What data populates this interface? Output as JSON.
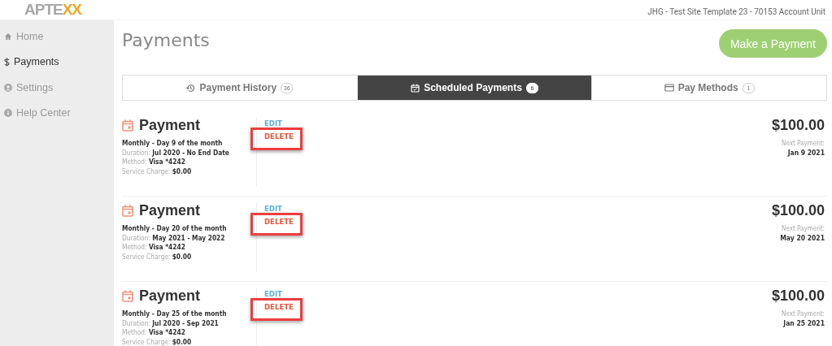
{
  "header": {
    "logo": {
      "main": "APTE",
      "accent": "XX"
    },
    "account": "JHG - Test Site Template 23 - 70153 Account Unit"
  },
  "sidebar": {
    "items": [
      {
        "label": "Home",
        "selected": false
      },
      {
        "label": "Payments",
        "selected": true
      },
      {
        "label": "Settings",
        "selected": false
      },
      {
        "label": "Help Center",
        "selected": false
      }
    ]
  },
  "page": {
    "title": "Payments",
    "action_button": "Make a Payment"
  },
  "tabs": [
    {
      "label": "Payment History",
      "count": "36",
      "selected": false
    },
    {
      "label": "Scheduled Payments",
      "count": "6",
      "selected": true
    },
    {
      "label": "Pay Methods",
      "count": "1",
      "selected": false
    }
  ],
  "payments": [
    {
      "title": "Payment",
      "frequency": "Monthly - Day 9 of the month",
      "duration": {
        "label": "Duration:",
        "value": "Jul 2020 - No End Date"
      },
      "method": {
        "label": "Method:",
        "value": "Visa *4242"
      },
      "service_charge": {
        "label": "Service Charge:",
        "value": "$0.00"
      },
      "edit": "EDIT",
      "delete": "DELETE",
      "highlighted": true,
      "amount": "$100.00",
      "next_label": "Next Payment:",
      "next_date": "Jan 9 2021"
    },
    {
      "title": "Payment",
      "frequency": "Monthly - Day 20 of the month",
      "duration": {
        "label": "Duration:",
        "value": "May 2021 - May 2022"
      },
      "method": {
        "label": "Method:",
        "value": "Visa *4242"
      },
      "service_charge": {
        "label": "Service Charge:",
        "value": "$0.00"
      },
      "edit": "EDIT",
      "delete": "DELETE",
      "highlighted": true,
      "amount": "$100.00",
      "next_label": "Next Payment:",
      "next_date": "May 20 2021"
    },
    {
      "title": "Payment",
      "frequency": "Monthly - Day 25 of the month",
      "duration": {
        "label": "Duration:",
        "value": "Jul 2020 - Sep 2021"
      },
      "method": {
        "label": "Method:",
        "value": "Visa *4242"
      },
      "service_charge": {
        "label": "Service Charge:",
        "value": "$0.00"
      },
      "edit": "EDIT",
      "delete": "DELETE",
      "highlighted": true,
      "amount": "$100.00",
      "next_label": "Next Payment:",
      "next_date": "Jan 25 2021"
    }
  ]
}
